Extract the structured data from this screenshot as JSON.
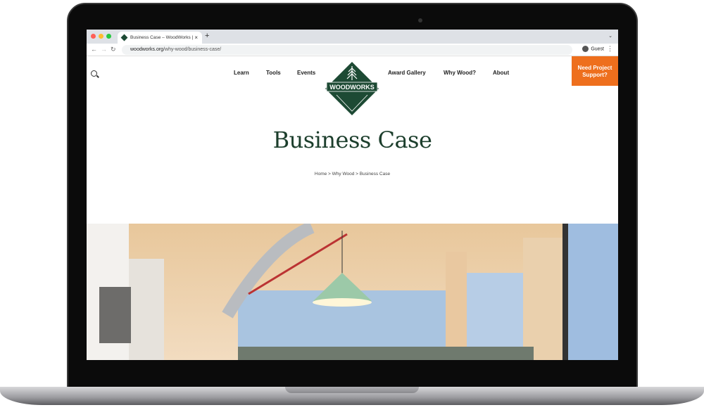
{
  "browser": {
    "tab_title": "Business Case – WoodWorks |",
    "url_domain": "woodworks.org",
    "url_path": "/why-wood/business-case/",
    "profile": "Guest"
  },
  "nav": {
    "items": [
      "Learn",
      "Tools",
      "Events",
      "Award Gallery",
      "Why Wood?",
      "About"
    ],
    "cta_line1": "Need Project",
    "cta_line2": "Support?"
  },
  "logo": {
    "text": "WOODWORKS"
  },
  "page": {
    "title": "Business Case",
    "breadcrumb": "Home > Why Wood > Business Case"
  },
  "colors": {
    "brand_green": "#1d4a34",
    "cta_orange": "#ee6f1d"
  }
}
